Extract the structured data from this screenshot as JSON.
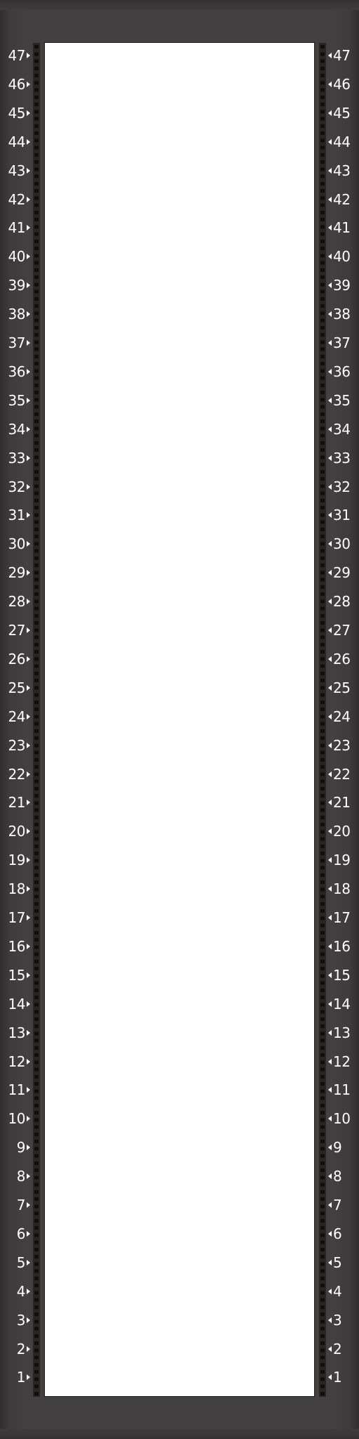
{
  "rack": {
    "unit_count": 47,
    "units_top_to_bottom": [
      "47",
      "46",
      "45",
      "44",
      "43",
      "42",
      "41",
      "40",
      "39",
      "38",
      "37",
      "36",
      "35",
      "34",
      "33",
      "32",
      "31",
      "30",
      "29",
      "28",
      "27",
      "26",
      "25",
      "24",
      "23",
      "22",
      "21",
      "20",
      "19",
      "18",
      "17",
      "16",
      "15",
      "14",
      "13",
      "12",
      "11",
      "10",
      "9",
      "8",
      "7",
      "6",
      "5",
      "4",
      "3",
      "2",
      "1"
    ],
    "colors": {
      "frame": "#424040",
      "rail": "#2b2424",
      "rail_hole": "#120d0d",
      "slot_area": "#ffffff",
      "label_text": "#ffffff"
    }
  }
}
